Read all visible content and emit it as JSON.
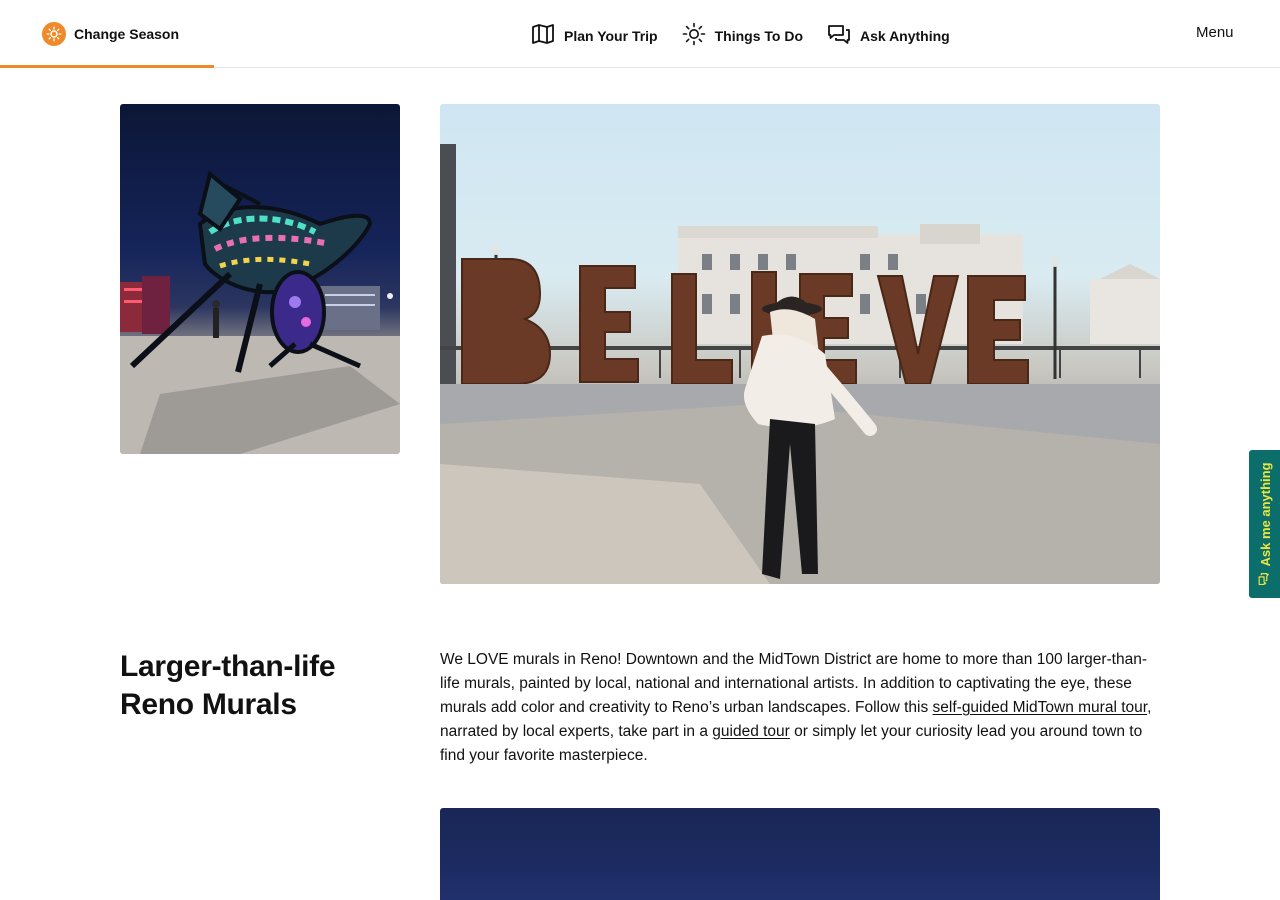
{
  "header": {
    "season_label": "Change Season",
    "nav": [
      {
        "label": "Plan Your Trip",
        "icon": "map-icon"
      },
      {
        "label": "Things To Do",
        "icon": "sun-icon"
      },
      {
        "label": "Ask Anything",
        "icon": "chat-icon"
      }
    ],
    "menu_label": "Menu"
  },
  "images": {
    "left": "light-up-sculpture-at-night",
    "main": "believe-sign-woman-walking",
    "bottom": "night-sky-image"
  },
  "section": {
    "heading": "Larger-than-life Reno Murals",
    "para_part1": "We LOVE murals in Reno! Downtown and the MidTown District are home to more than 100 larger-than-life murals, painted by local, national and international artists. In addition to captivating the eye, these murals add color and creativity to Reno’s urban landscapes. Follow this ",
    "link1": "self-guided MidTown mural tour",
    "para_part2": ", narrated by local experts, take part in a ",
    "link2": "guided tour",
    "para_part3": " or simply let your curiosity lead you around town to find your favorite masterpiece."
  },
  "ask_tab": {
    "label": "Ask me anything",
    "icon": "chat-icon"
  },
  "colors": {
    "accent": "#ef8a2a",
    "ask_bg": "#0b6e6a",
    "ask_text": "#e8e640"
  }
}
